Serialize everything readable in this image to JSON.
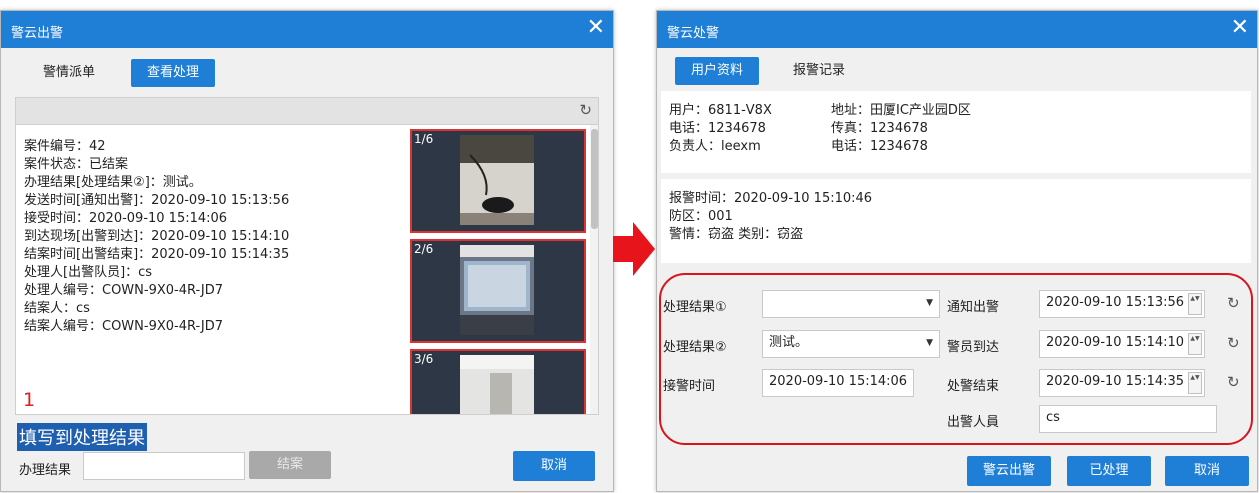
{
  "left_dialog": {
    "title": "警云出警",
    "close": "✕",
    "tabs": [
      {
        "label": "警情派单",
        "active": false
      },
      {
        "label": "查看处理",
        "active": true
      }
    ],
    "refresh_icon": "↻",
    "info": [
      "案件编号：42",
      "案件状态：已结案",
      "办理结果[处理结果②]：测试。",
      "发送时间[通知出警]：2020-09-10 15:13:56",
      "接受时间：2020-09-10 15:14:06",
      "到达现场[出警到达]：2020-09-10 15:14:10",
      "结案时间[出警结束]：2020-09-10 15:14:35",
      "处理人[出警队员]：cs",
      "处理人编号：COWN-9X0-4R-JD7",
      "结案人：cs",
      "结案人编号：COWN-9X0-4R-JD7"
    ],
    "photos": [
      "1/6",
      "2/6",
      "3/6"
    ],
    "annotation_number": "1",
    "annotation_text": "填写到处理结果",
    "result_label": "办理结果",
    "result_value": "",
    "close_case_button": "结案",
    "cancel_button": "取消"
  },
  "arrow_color": "#e8141c",
  "right_dialog": {
    "title": "警云处警",
    "close": "✕",
    "tabs": [
      {
        "label": "用户资料",
        "active": true
      },
      {
        "label": "报警记录",
        "active": false
      }
    ],
    "user_info": {
      "user": "用户：6811-V8X",
      "address": "地址：田厦IC产业园D区",
      "phone": "电话：1234678",
      "fax": "传真：1234678",
      "person": "负责人：leexm",
      "phone2": "电话：1234678"
    },
    "alarm_info": {
      "time": "报警时间：2020-09-10 15:10:46",
      "zone": "防区：001",
      "type": "警情：窃盗   类别：窃盗"
    },
    "form": {
      "result1_label": "处理结果①",
      "result1_value": "",
      "result2_label": "处理结果②",
      "result2_value": "测试。",
      "accept_label": "接警时间",
      "accept_value": "2020-09-10 15:14:06",
      "notify_label": "通知出警",
      "notify_value": "2020-09-10 15:13:56",
      "arrive_label": "警员到达",
      "arrive_value": "2020-09-10 15:14:10",
      "end_label": "处警结束",
      "end_value": "2020-09-10 15:14:35",
      "officer_label": "出警人員",
      "officer_value": "cs",
      "dropdown_icon": "▼",
      "spinner_icon": "▲▼",
      "refresh_icon": "↻"
    },
    "buttons": {
      "dispatch": "警云出警",
      "processed": "已处理",
      "cancel": "取消"
    },
    "highlight_color": "#d8141c"
  }
}
